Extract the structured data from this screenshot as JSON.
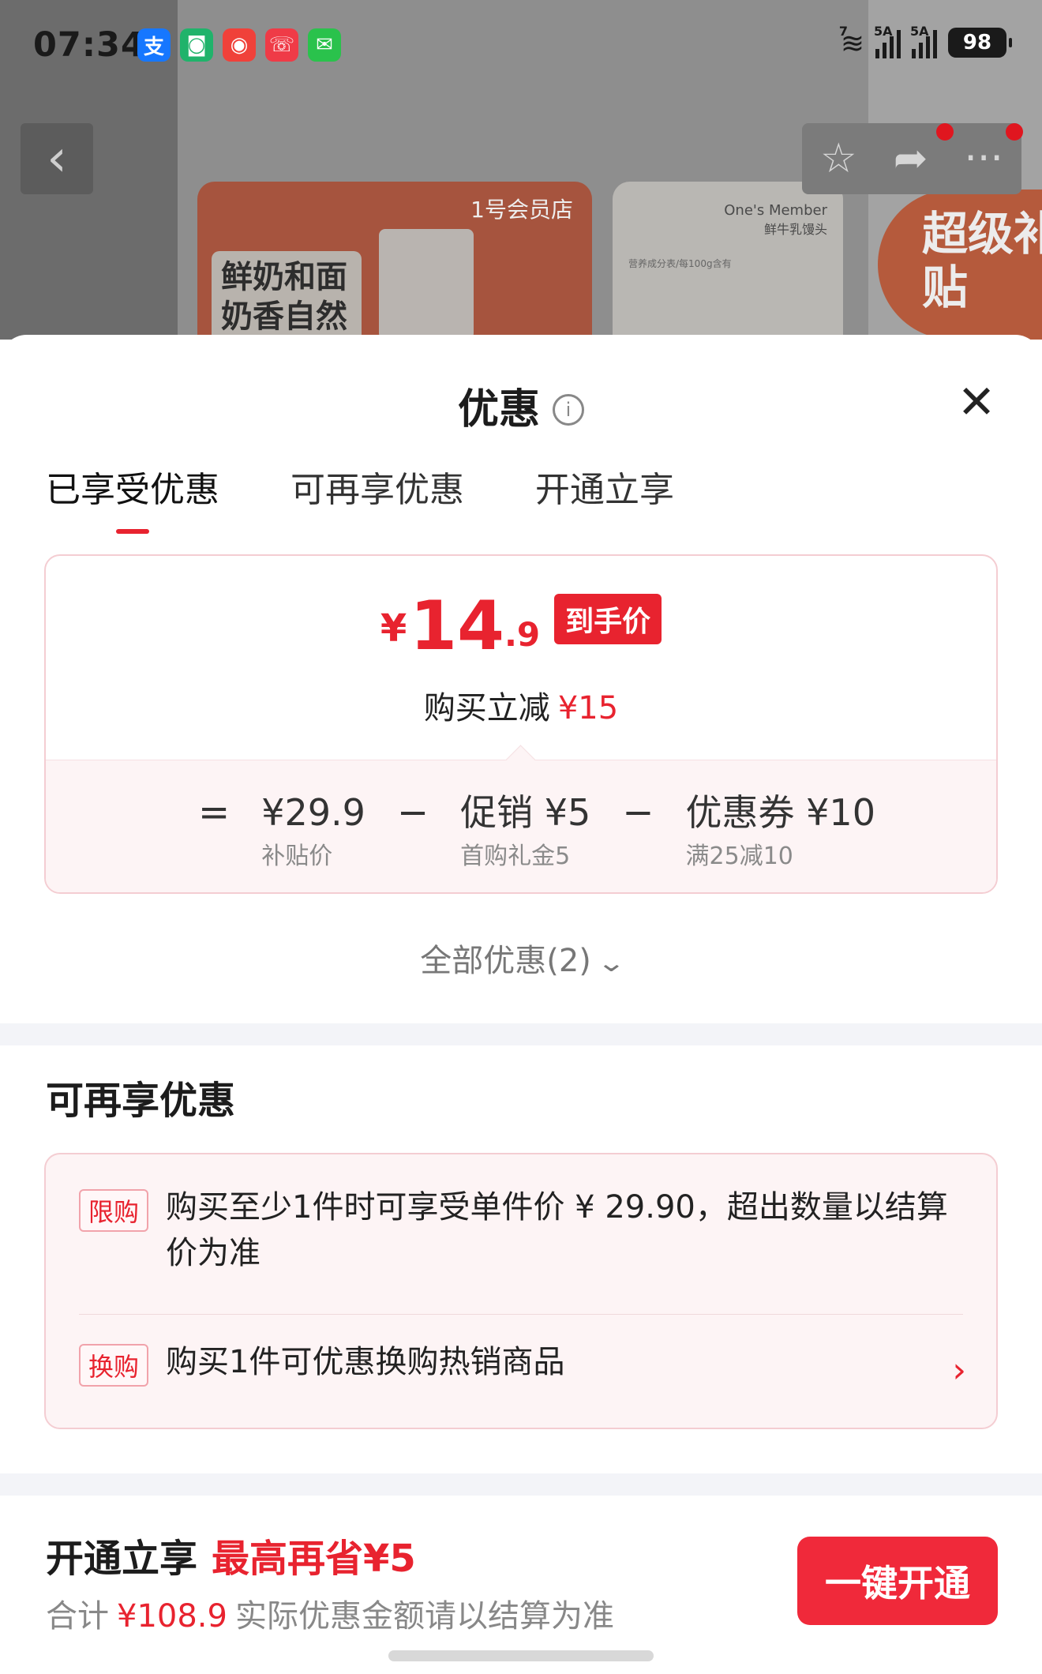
{
  "status_bar": {
    "time": "07:34",
    "apps": [
      {
        "name": "alipay-icon",
        "glyph": "支",
        "color": "#1677ff"
      },
      {
        "name": "app-green-icon",
        "glyph": "◙",
        "color": "#20b36b"
      },
      {
        "name": "app-red-icon",
        "glyph": "◉",
        "color": "#f0413a"
      },
      {
        "name": "app-missed-call-icon",
        "glyph": "☏",
        "color": "#ef3b47"
      },
      {
        "name": "wechat-icon",
        "glyph": "✉",
        "color": "#2ac24c"
      }
    ],
    "wifi_label": "7",
    "signal1_label": "5A",
    "signal2_label": "5A",
    "battery": "98"
  },
  "background": {
    "banner1_label": "鲜奶和面奶香自然",
    "banner1_logo": "1号会员店",
    "banner2_title": "One's Member",
    "banner2_subtitle": "鲜牛乳馒头",
    "banner2_table_caption": "营养成分表/每100g含有",
    "banner3_label": "超级补贴"
  },
  "sheet": {
    "title": "优惠",
    "tabs": [
      {
        "label": "已享受优惠",
        "active": true
      },
      {
        "label": "可再享优惠",
        "active": false
      },
      {
        "label": "开通立享",
        "active": false
      }
    ],
    "price": {
      "currency": "¥",
      "integer": "14",
      "decimal": ".9",
      "badge": "到手价",
      "reduce_label": "购买立减",
      "reduce_amount": "¥15"
    },
    "formula": {
      "equals": "=",
      "minus": "−",
      "terms": [
        {
          "value": "¥29.9",
          "sub": "补贴价"
        },
        {
          "value": "促销 ¥5",
          "sub": "首购礼金5"
        },
        {
          "value": "优惠券 ¥10",
          "sub": "满25减10"
        }
      ]
    },
    "all_offers": "全部优惠(2)",
    "section2_title": "可再享优惠",
    "offers": [
      {
        "tag": "限购",
        "text": "购买至少1件时可享受单件价 ¥ 29.90，超出数量以结算价为准"
      },
      {
        "tag": "换购",
        "text": "购买1件可优惠换购热销商品"
      }
    ],
    "footer": {
      "title": "开通立享",
      "highlight": "最高再省¥5",
      "sub_prefix": "合计",
      "sub_amount": "¥108.9",
      "sub_suffix": "实际优惠金额请以结算为准",
      "button": "一键开通"
    }
  },
  "colors": {
    "accent": "#e8232f",
    "card_bg": "#fdf4f5",
    "card_border": "#f4cdd2"
  }
}
